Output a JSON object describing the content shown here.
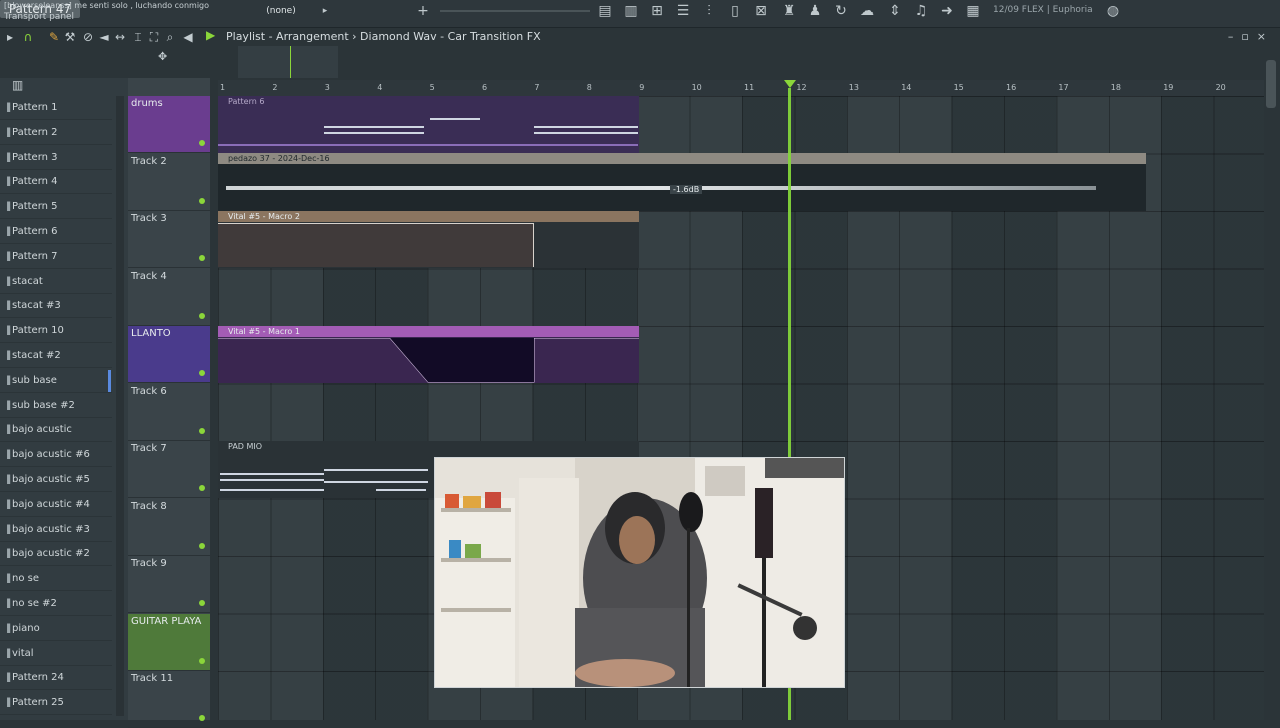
{
  "topbar": {
    "hint_line1": "[blowerseleanss] me senti solo , luchando conmigo",
    "hint_line2": "Transport panel",
    "pattern_none": "(none)",
    "pattern_selector": "Pattern 47",
    "cpu_info": "12/09  FLEX | Euphoria"
  },
  "playlist": {
    "title": "Playlist - Arrangement › Diamond Wav - Car Transition FX"
  },
  "browser": {
    "patterns": [
      "Pattern 1",
      "Pattern 2",
      "Pattern 3",
      "Pattern 4",
      "Pattern 5",
      "Pattern 6",
      "Pattern 7",
      "stacat",
      "stacat #3",
      "Pattern 10",
      "stacat #2",
      "sub base",
      "sub base #2",
      "bajo acustic",
      "bajo acustic #6",
      "bajo acustic #5",
      "bajo acustic #4",
      "bajo acustic #3",
      "bajo acustic #2",
      "no se",
      "no se #2",
      "piano",
      "vital",
      "Pattern 24",
      "Pattern 25"
    ]
  },
  "tracks": [
    {
      "name": "drums",
      "color": "#6a3d8f"
    },
    {
      "name": "Track 2",
      "color": ""
    },
    {
      "name": "Track 3",
      "color": ""
    },
    {
      "name": "Track 4",
      "color": ""
    },
    {
      "name": "LLANTO",
      "color": "#4a3b8c"
    },
    {
      "name": "Track 6",
      "color": ""
    },
    {
      "name": "Track 7",
      "color": ""
    },
    {
      "name": "Track 8",
      "color": ""
    },
    {
      "name": "Track 9",
      "color": ""
    },
    {
      "name": "GUITAR PLAYA",
      "color": "#4f7a3a"
    },
    {
      "name": "Track 11",
      "color": ""
    }
  ],
  "ruler": [
    "1",
    "2",
    "3",
    "4",
    "5",
    "6",
    "7",
    "8",
    "9",
    "10",
    "11",
    "12",
    "13",
    "14",
    "15",
    "16",
    "17",
    "18",
    "19",
    "20"
  ],
  "clips": {
    "pattern6": "Pattern 6",
    "audio": "pedazo 37 - 2024-Dec-16",
    "audio_db": "-1.6dB",
    "auto1": "Vital #5 - Macro 2",
    "auto2": "Vital #5 - Macro 1",
    "pad": "PAD MIO"
  },
  "colors": {
    "accent_green": "#8bd63a",
    "drums_clip": "#3a2a5a",
    "automation_clip": "#5a4860",
    "llanto_clip": "#3a2650"
  },
  "icons": [
    "play-icon",
    "record-icon",
    "pencil-icon",
    "brush-icon",
    "delete-icon",
    "mute-icon",
    "slip-icon",
    "select-icon",
    "zoom-icon",
    "speaker-icon",
    "playlist-play-icon"
  ]
}
